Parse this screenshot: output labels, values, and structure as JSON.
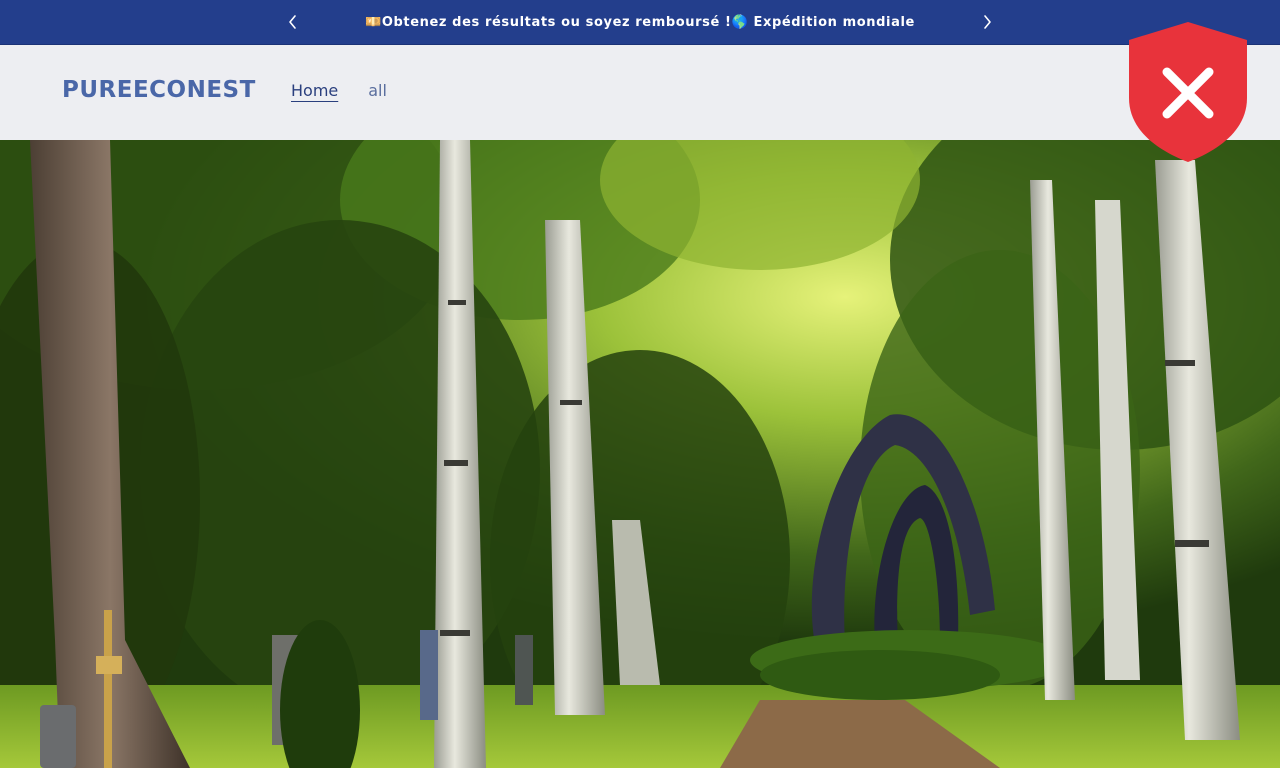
{
  "announcement": {
    "text": "💴Obtenez des résultats ou soyez remboursé !🌎 Expédition mondiale",
    "prev_icon": "chevron-left-icon",
    "next_icon": "chevron-right-icon"
  },
  "header": {
    "logo": "PUREECONEST",
    "nav": [
      {
        "label": "Home"
      },
      {
        "label": "all"
      }
    ]
  },
  "overlay": {
    "icon": "security-shield-x-icon",
    "color": "#e8333b"
  },
  "hero": {
    "image": "forest-cemetery-path-with-arch-sculpture"
  },
  "colors": {
    "announcement_bg": "#233e8c",
    "header_bg": "#edeef2",
    "logo": "#4a67a8",
    "nav_active": "#2a3f7e"
  }
}
